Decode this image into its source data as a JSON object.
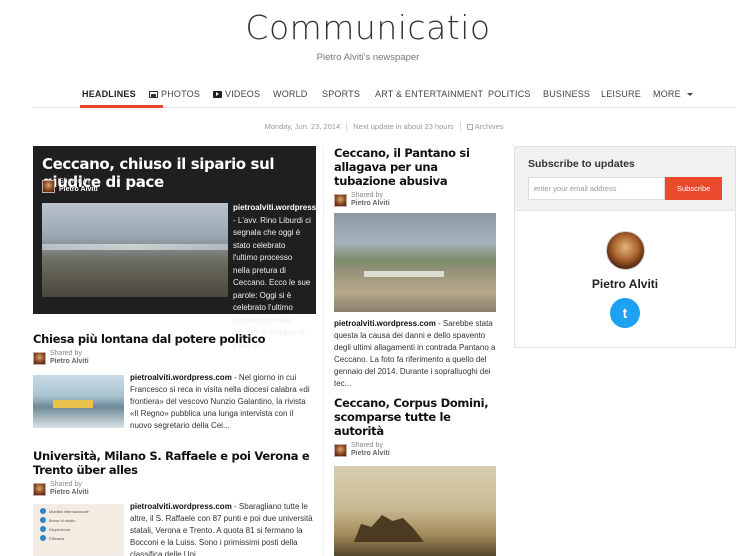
{
  "site": {
    "title": "Communicatio",
    "tagline": "Pietro Alviti's newspaper"
  },
  "nav": {
    "items": [
      "HEADLINES",
      "PHOTOS",
      "VIDEOS",
      "WORLD",
      "SPORTS",
      "ART & ENTERTAINMENT",
      "POLITICS",
      "BUSINESS",
      "LEISURE",
      "MORE"
    ],
    "active": "HEADLINES"
  },
  "infobar": {
    "date": "Monday, Jun. 23, 2014",
    "next_update": "Next update in about 23 hours",
    "archives": "Archives"
  },
  "feature": {
    "title": "Ceccano, chiuso il sipario sul giudice di pace",
    "shared_by": "Shared by",
    "author": "Pietro Alviti",
    "source": "pietroalviti.wordpress.com",
    "excerpt": " - L'avv. Rino Liburdi ci segnala che oggi è stato celebrato l'ultimo processo nella pretura di Ceccano. Ecco le sue parole: Oggi si è celebrato l'ultimo processo penale innanzi al Giudice di Pace di ..."
  },
  "stories": [
    {
      "title": "Chiesa più lontana dal potere politico",
      "shared_by": "Shared by",
      "author": "Pietro Alviti",
      "source": "pietroalviti.wordpress.com",
      "excerpt": " - Nel giorno in cui Francesco si reca in visita nella diocesi calabra «di frontiera» del vescovo Nunzio Galantino, la rivista «Il Regno» pubblica una lunga intervista con il nuovo segretario della Cei..."
    },
    {
      "title": "Università, Milano S. Raffaele e poi Verona e Trento über alles",
      "shared_by": "Shared by",
      "author": "Pietro Alviti",
      "source": "pietroalviti.wordpress.com",
      "excerpt": " - Sbaragliano tutte le altre, il S. Raffaele con 87 punti e poi due università statali, Verona e Trento. A quota 81 si fermano la Bocconi e la Luiss. Sono i primissimi posti della classifica delle Uni..."
    },
    {
      "title": "Ceccano, il Pantano si allagava per una tubazione abusiva",
      "shared_by": "Shared by",
      "author": "Pietro Alviti",
      "source": "pietroalviti.wordpress.com",
      "excerpt": " - Sarebbe stata questa la causa dei danni e dello spavento degli ultimi allagamenti in contrada Pantano a Ceccano. La foto fa riferimento a quello del gennaio del 2014. Durante i sopralluoghi dei tec..."
    },
    {
      "title": "Ceccano, Corpus Domini, scomparse tutte le autorità",
      "shared_by": "Shared by",
      "author": "Pietro Alviti"
    }
  ],
  "infographic": [
    "Mobilità internazionale",
    "Borse di studio",
    "Dispersione",
    "Efficacia"
  ],
  "sidebar": {
    "subscribe_title": "Subscribe to updates",
    "email_placeholder": "enter your email address",
    "subscribe_button": "Subscribe",
    "profile_name": "Pietro Alviti",
    "twitter_glyph": "t",
    "twitter_icon": "twitter-icon"
  }
}
